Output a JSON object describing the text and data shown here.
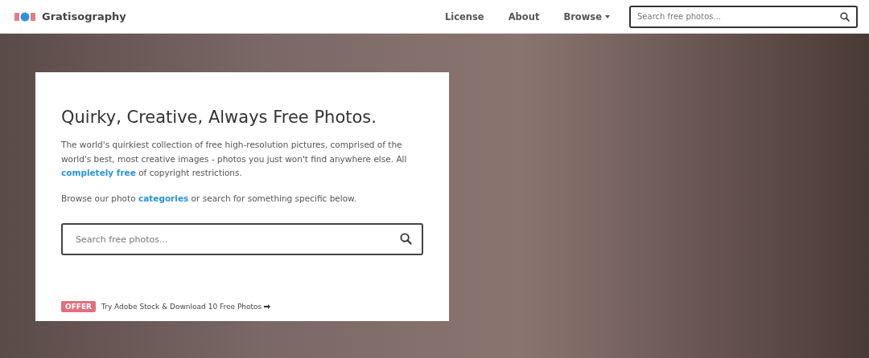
{
  "header": {
    "logo_text": "Gratisography",
    "nav": [
      {
        "label": "License",
        "dropdown": false
      },
      {
        "label": "About",
        "dropdown": false
      },
      {
        "label": "Browse",
        "dropdown": true
      }
    ],
    "search": {
      "placeholder": "Search free photos..."
    }
  },
  "hero": {
    "title": "Quirky, Creative, Always Free Photos.",
    "paragraphs": [
      [
        {
          "kind": "text",
          "text": "The world's quirkiest collection of free high-resolution pictures, comprised of the world's best, most creative images - photos you just won't find anywhere else. All "
        },
        {
          "kind": "link",
          "text": "completely free"
        },
        {
          "kind": "text",
          "text": " of copyright restrictions."
        }
      ],
      [
        {
          "kind": "text",
          "text": "Browse our photo "
        },
        {
          "kind": "link",
          "text": "categories"
        },
        {
          "kind": "text",
          "text": " or search for something specific below."
        }
      ]
    ],
    "search": {
      "placeholder": "Search free photos..."
    },
    "offer": {
      "badge": "OFFER",
      "text": "Try Adobe Stock & Download 10 Free Photos"
    }
  }
}
